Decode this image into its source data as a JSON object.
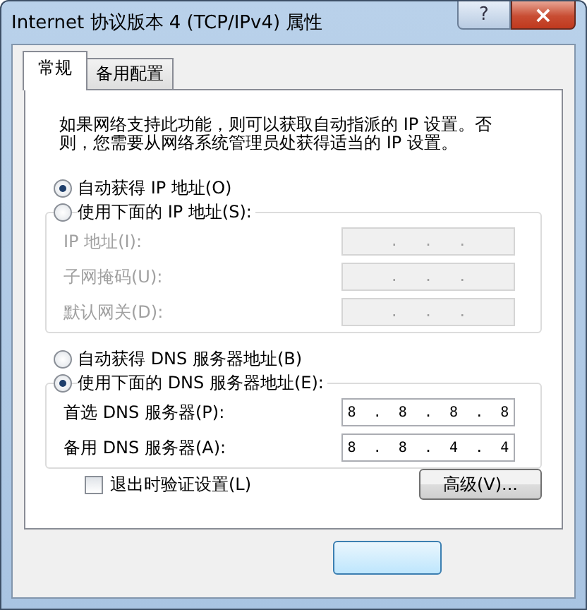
{
  "window": {
    "title": "Internet 协议版本 4 (TCP/IPv4) 属性",
    "help": "?",
    "close": "×"
  },
  "tabs": [
    {
      "label": "常规",
      "selected": true
    },
    {
      "label": "备用配置",
      "selected": false
    }
  ],
  "intro": "如果网络支持此功能，则可以获取自动指派的 IP 设置。否则，您需要从网络系统管理员处获得适当的 IP 设置。",
  "ip_options": [
    {
      "label": "自动获得 IP 地址(O)",
      "selected": true
    },
    {
      "label": "使用下面的 IP 地址(S):",
      "selected": false
    }
  ],
  "ip_fields": [
    {
      "label": "IP 地址(I):",
      "value": ".   .   .",
      "disabled": true
    },
    {
      "label": "子网掩码(U):",
      "value": ".   .   .",
      "disabled": true
    },
    {
      "label": "默认网关(D):",
      "value": ".   .   .",
      "disabled": true
    }
  ],
  "dns_options": [
    {
      "label": "自动获得 DNS 服务器地址(B)",
      "selected": false
    },
    {
      "label": "使用下面的 DNS 服务器地址(E):",
      "selected": true
    }
  ],
  "dns_fields": [
    {
      "label": "首选 DNS 服务器(P):",
      "value": "8  .  8  .  8  .  8",
      "disabled": false
    },
    {
      "label": "备用 DNS 服务器(A):",
      "value": "8  .  8  .  4  .  4",
      "disabled": false
    }
  ],
  "validate": {
    "label": "退出时验证设置(L)",
    "checked": false
  },
  "advanced_button": "高级(V)..."
}
